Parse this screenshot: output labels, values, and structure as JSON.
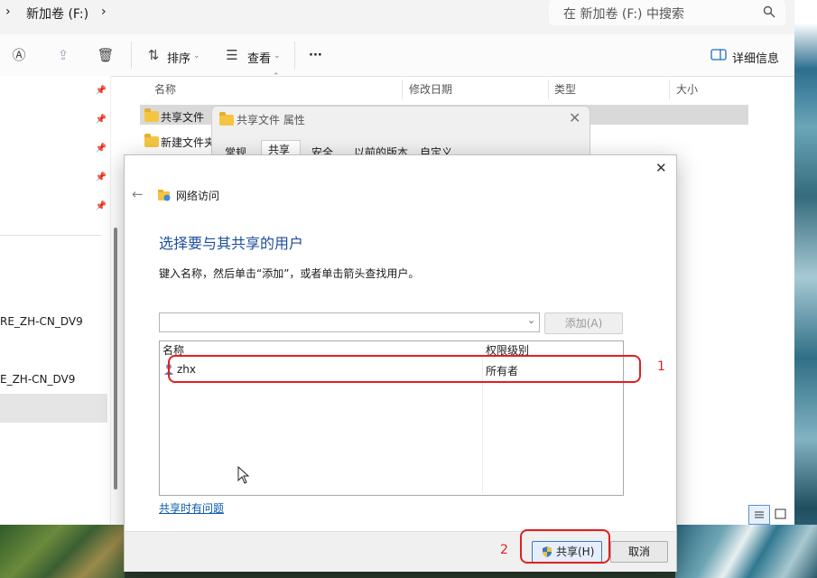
{
  "explorer": {
    "breadcrumb": [
      "新加卷 (F:)"
    ],
    "search_placeholder": "在 新加卷 (F:) 中搜索",
    "toolbar": {
      "sort": "排序",
      "view": "查看",
      "more": "···",
      "details": "详细信息"
    },
    "columns": [
      "名称",
      "修改日期",
      "类型",
      "大小"
    ],
    "files": [
      "共享文件",
      "新建文件夹"
    ],
    "nav_items": [
      "RE_ZH-CN_DV9",
      "E_ZH-CN_DV9"
    ]
  },
  "properties": {
    "title": "共享文件 属性",
    "tabs": [
      "常规",
      "共享",
      "安全",
      "以前的版本",
      "自定义"
    ]
  },
  "dialog": {
    "nav_title": "网络访问",
    "heading": "选择要与其共享的用户",
    "instruction": "键入名称，然后单击“添加”，或者单击箭头查找用户。",
    "add_button": "添加(A)",
    "list_columns": [
      "名称",
      "权限级别"
    ],
    "users": [
      {
        "name": "zhx",
        "permission": "所有者"
      }
    ],
    "help_link": "共享时有问题",
    "share_button": "共享(H)",
    "cancel_button": "取消"
  },
  "annotations": [
    "1",
    "2"
  ],
  "colors": {
    "heading": "#1e4e9c",
    "annotation": "#e02020",
    "folder": "#f5c542",
    "link": "#0a5aa8"
  },
  "icons": [
    "chevron-right-icon",
    "search-icon",
    "ai-translate-icon",
    "share-icon",
    "trash-icon",
    "sort-icon",
    "view-icon",
    "details-pane-icon",
    "pin-icon",
    "folder-icon",
    "close-icon",
    "back-arrow-icon",
    "network-folder-icon",
    "dropdown-arrow-icon",
    "user-icon",
    "shield-icon",
    "mouse-cursor-icon",
    "list-view-icon",
    "tile-view-icon"
  ]
}
